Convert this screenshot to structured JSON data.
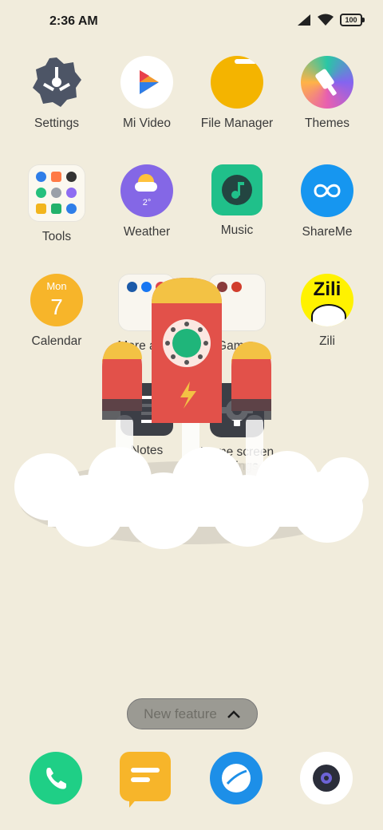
{
  "status_bar": {
    "time": "2:36 AM",
    "battery": "100"
  },
  "apps": [
    {
      "label": "Settings",
      "icon": "settings-icon"
    },
    {
      "label": "Mi Video",
      "icon": "video-play-icon"
    },
    {
      "label": "File Manager",
      "icon": "folder-icon"
    },
    {
      "label": "Themes",
      "icon": "paintbrush-icon"
    },
    {
      "label": "Tools",
      "icon": "tools-folder-icon"
    },
    {
      "label": "Weather",
      "icon": "weather-icon",
      "badge": "2°"
    },
    {
      "label": "Music",
      "icon": "music-icon"
    },
    {
      "label": "ShareMe",
      "icon": "infinity-icon"
    },
    {
      "label": "Calendar",
      "icon": "calendar-icon",
      "day": "Mon",
      "date": "7"
    },
    {
      "label": "More apps",
      "icon": "folder-icon"
    },
    {
      "label": "Games",
      "icon": "folder-icon"
    },
    {
      "label": "Zili",
      "icon": "zili-icon",
      "logo_text": "Zili"
    },
    {
      "label": "Notes",
      "icon": "notes-icon"
    },
    {
      "label": "Home screen settings",
      "icon": "gear-icon"
    }
  ],
  "new_feature": {
    "label": "New feature"
  },
  "dock": [
    {
      "name": "phone",
      "icon": "phone-icon"
    },
    {
      "name": "messages",
      "icon": "message-icon"
    },
    {
      "name": "browser",
      "icon": "browser-icon"
    },
    {
      "name": "camera",
      "icon": "camera-icon"
    }
  ],
  "colors": {
    "background": "#f1ecdc",
    "rocket_red": "#e2514a",
    "rocket_yellow": "#f3c244",
    "accent_green": "#1fb57a"
  }
}
